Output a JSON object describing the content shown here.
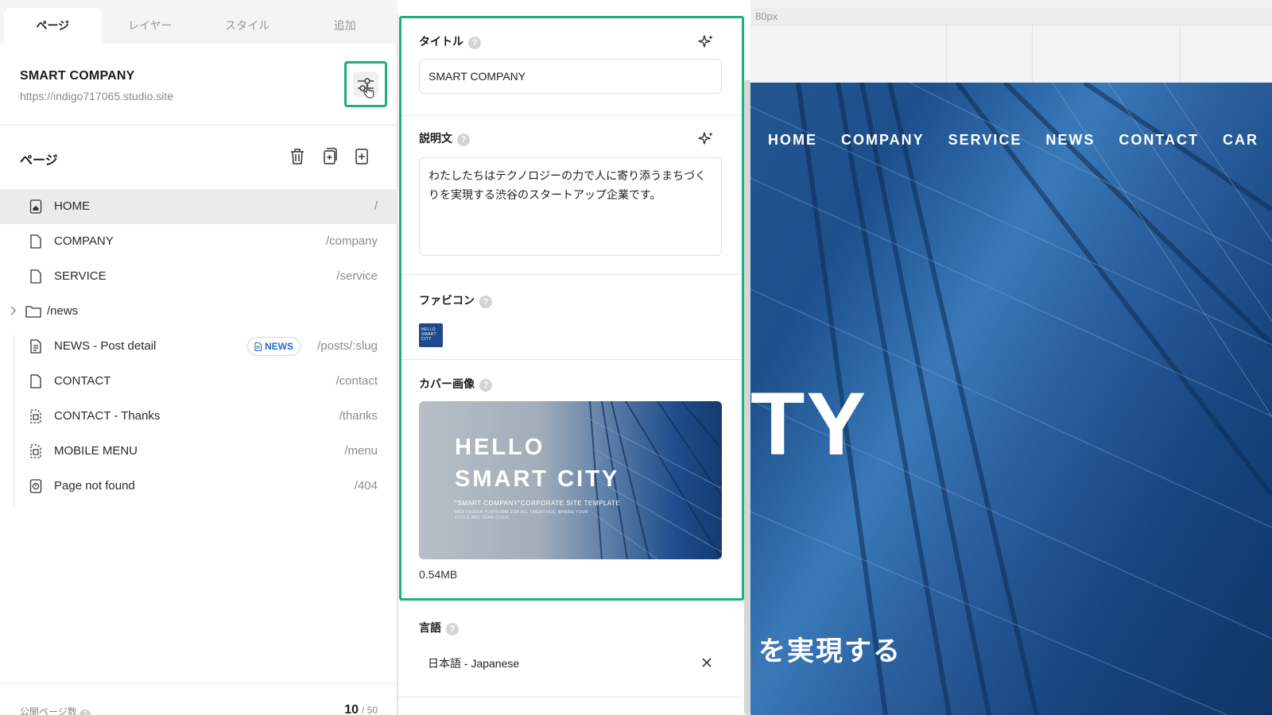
{
  "tabs": [
    {
      "label": "ページ",
      "active": true
    },
    {
      "label": "レイヤー",
      "active": false
    },
    {
      "label": "スタイル",
      "active": false
    },
    {
      "label": "追加",
      "active": false
    }
  ],
  "site": {
    "title": "SMART COMPANY",
    "url": "https://indigo717065.studio.site"
  },
  "pages_section": {
    "title": "ページ",
    "icons": [
      "trash-icon",
      "duplicate-page-icon",
      "add-page-icon"
    ]
  },
  "pages": [
    {
      "name": "HOME",
      "path": "/",
      "icon": "home-page-icon",
      "selected": true
    },
    {
      "name": "COMPANY",
      "path": "/company",
      "icon": "page-icon"
    },
    {
      "name": "SERVICE",
      "path": "/service",
      "icon": "page-icon"
    },
    {
      "name": "/news",
      "path": "",
      "icon": "folder-icon",
      "folder": true
    },
    {
      "name": "NEWS - Post detail",
      "badge": "NEWS",
      "path": "/posts/:slug",
      "icon": "cms-page-icon"
    },
    {
      "name": "CONTACT",
      "path": "/contact",
      "icon": "page-icon"
    },
    {
      "name": "CONTACT - Thanks",
      "path": "/thanks",
      "icon": "hidden-page-icon"
    },
    {
      "name": "MOBILE MENU",
      "path": "/menu",
      "icon": "hidden-page-icon"
    },
    {
      "name": "Page not found",
      "path": "/404",
      "icon": "404-page-icon"
    }
  ],
  "footer": {
    "label": "公開ページ数",
    "count": "10",
    "limit": "/ 50"
  },
  "settings": {
    "title_label": "タイトル",
    "title_value": "SMART COMPANY",
    "desc_label": "説明文",
    "desc_value": "わたしたちはテクノロジーの力で人に寄り添うまちづくりを実現する渋谷のスタートアップ企業です。",
    "favicon_label": "ファビコン",
    "favicon_text": "HELLO SMART CITY",
    "cover_label": "カバー画像",
    "cover": {
      "line1": "HELLO",
      "line2": "SMART CITY",
      "line3": "\"SMART COMPANY\"CORPORATE SITE TEMPLATE",
      "line4": "WEB DESIGN PLATFORM FOR ALL CREATIVES. WHERE YOUR TOOLS AND TEAM CLICK."
    },
    "cover_size": "0.54MB",
    "lang_label": "言語",
    "lang_value": "日本語 - Japanese",
    "help_glyph": "?"
  },
  "canvas": {
    "ruler_label": "80px",
    "nav": [
      "HOME",
      "COMPANY",
      "SERVICE",
      "NEWS",
      "CONTACT",
      "CAR"
    ],
    "hero_big": "TY",
    "hero_sub": "を実現する"
  },
  "colors": {
    "highlight": "#1fae7d",
    "badge": "#1f6fd1",
    "hero": "#1d4f8c"
  }
}
